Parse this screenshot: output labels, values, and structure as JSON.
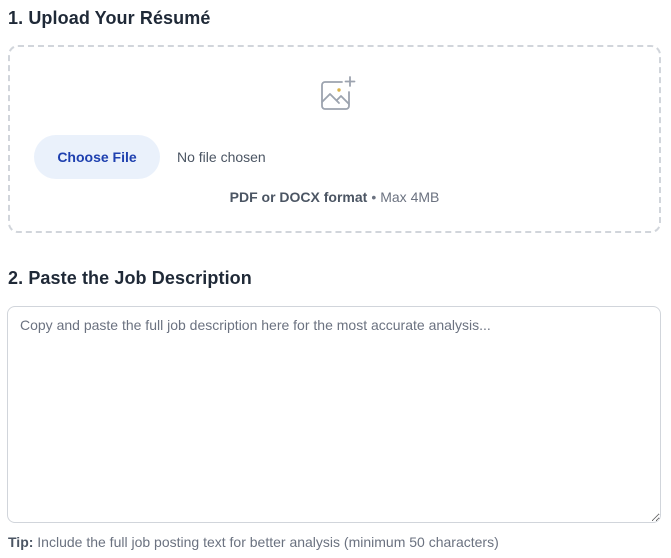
{
  "upload": {
    "title": "1. Upload Your Résumé",
    "choose_label": "Choose File",
    "file_status": "No file chosen",
    "format_strong": "PDF or DOCX format",
    "separator": "•",
    "max_size": "Max 4MB",
    "icon": "image-plus-icon"
  },
  "job": {
    "title": "2. Paste the Job Description",
    "placeholder": "Copy and paste the full job description here for the most accurate analysis...",
    "value": ""
  },
  "tip": {
    "label": "Tip:",
    "text": " Include the full job posting text for better analysis (minimum 50 characters)"
  },
  "colors": {
    "button_bg": "#eaf1fb",
    "button_text": "#1e40af",
    "border": "#d1d5db",
    "muted_text": "#6b7280"
  }
}
